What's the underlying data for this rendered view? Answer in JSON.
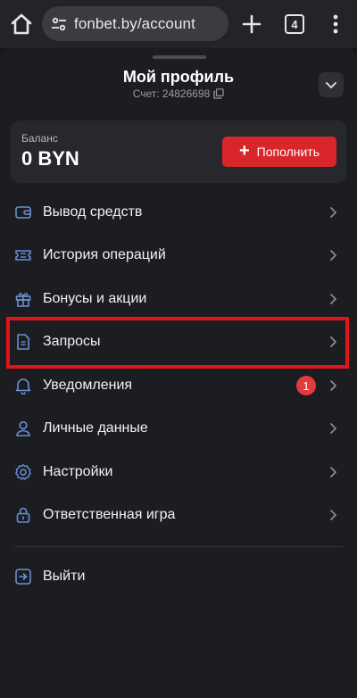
{
  "browser": {
    "url": "fonbet.by/account",
    "tab_count": "4"
  },
  "profile": {
    "title": "Мой профиль",
    "account_label": "Счет: 24826698"
  },
  "balance": {
    "label": "Баланс",
    "value": "0 BYN",
    "topup_label": "Пополнить",
    "topup_color": "#d8262b"
  },
  "menu": {
    "items": [
      {
        "label": "Вывод средств",
        "icon": "wallet-icon"
      },
      {
        "label": "История операций",
        "icon": "ticket-icon"
      },
      {
        "label": "Бонусы и акции",
        "icon": "gift-icon"
      },
      {
        "label": "Запросы",
        "icon": "document-icon",
        "highlighted": true
      },
      {
        "label": "Уведомления",
        "icon": "bell-icon",
        "badge": "1"
      },
      {
        "label": "Личные данные",
        "icon": "user-icon"
      },
      {
        "label": "Настройки",
        "icon": "gear-icon"
      },
      {
        "label": "Ответственная игра",
        "icon": "lock-icon"
      }
    ],
    "logout_label": "Выйти"
  },
  "colors": {
    "accent_red": "#d8262b",
    "highlight_red": "#e0141c",
    "icon_blue": "#6b8fd6"
  }
}
